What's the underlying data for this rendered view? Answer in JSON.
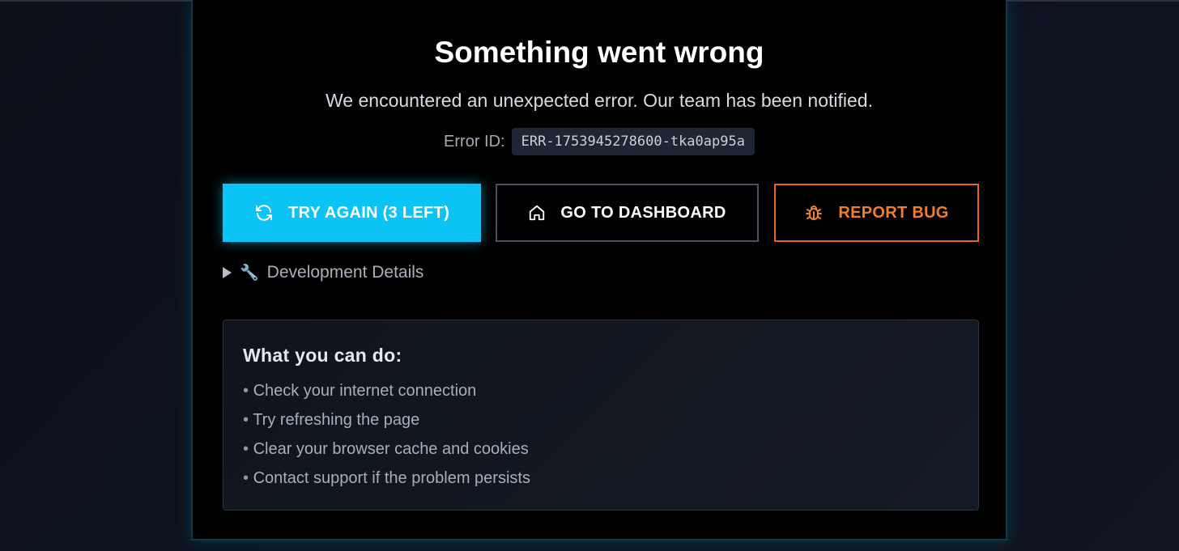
{
  "error": {
    "title": "Something went wrong",
    "message": "We encountered an unexpected error. Our team has been notified.",
    "id_label": "Error ID:",
    "id_value": "ERR-1753945278600-tka0ap95a"
  },
  "actions": {
    "try_again": {
      "label": "TRY AGAIN (3 LEFT)",
      "icon": "refresh-icon"
    },
    "dashboard": {
      "label": "GO TO DASHBOARD",
      "icon": "home-icon"
    },
    "report_bug": {
      "label": "REPORT BUG",
      "icon": "bug-icon"
    }
  },
  "dev_details": {
    "label": "Development Details",
    "icon": "wrench-icon",
    "expanded": false
  },
  "help": {
    "title": "What you can do:",
    "items": [
      "Check your internet connection",
      "Try refreshing the page",
      "Clear your browser cache and cookies",
      "Contact support if the problem persists"
    ]
  },
  "colors": {
    "accent": "#0bc3f5",
    "danger": "#e8651f",
    "background": "#000000"
  }
}
